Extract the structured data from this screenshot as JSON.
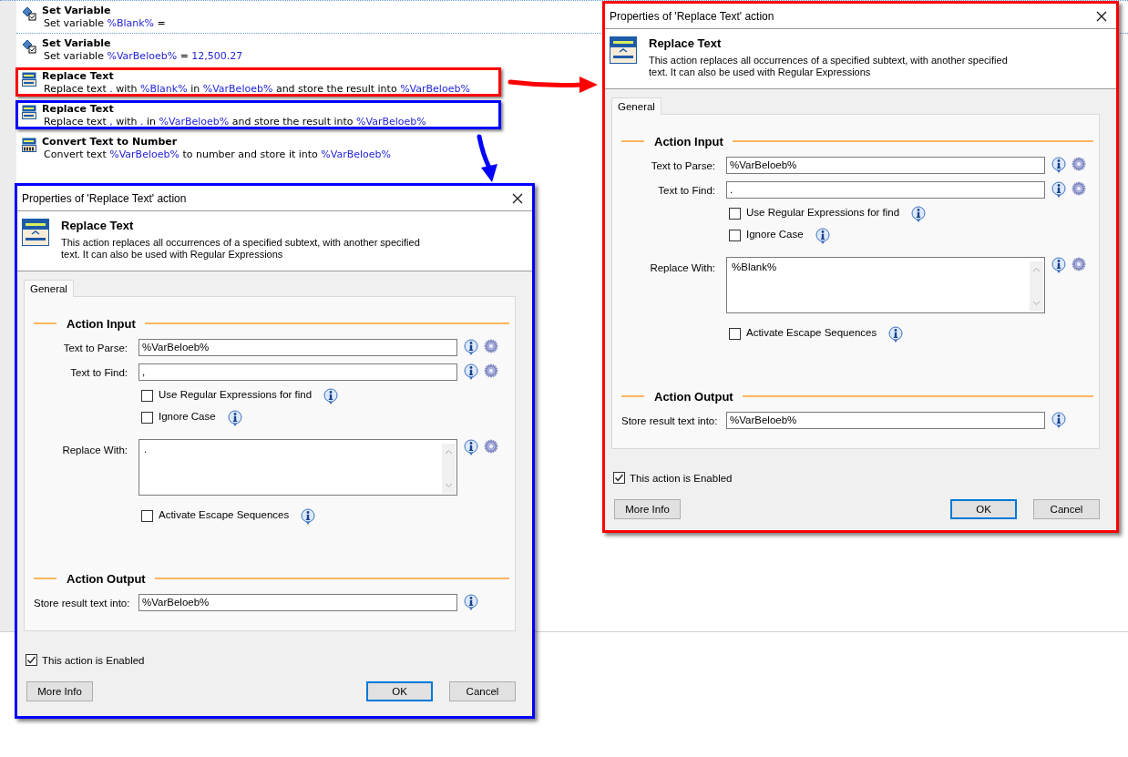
{
  "steps": [
    {
      "title": "Set Variable",
      "kind": "variable",
      "description": [
        {
          "kind": "plain",
          "text": "Set variable "
        },
        {
          "kind": "var",
          "text": "%Blank%"
        },
        {
          "kind": "plain",
          "text": " ="
        }
      ]
    },
    {
      "title": "Set Variable",
      "kind": "variable",
      "description": [
        {
          "kind": "plain",
          "text": "Set variable "
        },
        {
          "kind": "var",
          "text": "%VarBeloeb%"
        },
        {
          "kind": "plain",
          "text": " = "
        },
        {
          "kind": "var",
          "text": "12,500.27"
        }
      ]
    },
    {
      "title": "Replace Text",
      "kind": "replace",
      "color": "#ff0000",
      "description": [
        {
          "kind": "plain",
          "text": "Replace text "
        },
        {
          "kind": "var",
          "text": "."
        },
        {
          "kind": "plain",
          "text": " with "
        },
        {
          "kind": "var",
          "text": "%Blank%"
        },
        {
          "kind": "plain",
          "text": " in "
        },
        {
          "kind": "var",
          "text": "%VarBeloeb%"
        },
        {
          "kind": "plain",
          "text": " and store the result into "
        },
        {
          "kind": "var",
          "text": "%VarBeloeb%"
        }
      ]
    },
    {
      "title": "Replace Text",
      "kind": "replace",
      "color": "#0000ff",
      "description": [
        {
          "kind": "plain",
          "text": "Replace text "
        },
        {
          "kind": "var",
          "text": ","
        },
        {
          "kind": "plain",
          "text": " with "
        },
        {
          "kind": "var",
          "text": "."
        },
        {
          "kind": "plain",
          "text": " in "
        },
        {
          "kind": "var",
          "text": "%VarBeloeb%"
        },
        {
          "kind": "plain",
          "text": " and store the result into "
        },
        {
          "kind": "var",
          "text": "%VarBeloeb%"
        }
      ]
    },
    {
      "title": "Convert Text to Number",
      "kind": "convert",
      "description": [
        {
          "kind": "plain",
          "text": "Convert text "
        },
        {
          "kind": "var",
          "text": "%VarBeloeb%"
        },
        {
          "kind": "plain",
          "text": " to number and store it into "
        },
        {
          "kind": "var",
          "text": "%VarBeloeb%"
        }
      ]
    }
  ],
  "dialogs": [
    {
      "color": "#ff0000",
      "title": "Properties of 'Replace Text' action",
      "heading": "Replace Text",
      "description": "This action replaces all occurrences of a specified subtext, with another specified text. It can also be used with Regular Expressions",
      "tabs": [
        {
          "label": "General",
          "selected": true
        }
      ],
      "sections": [
        {
          "title": "Action Input",
          "rows": [
            {
              "kind": "text",
              "label": "Text to Parse:",
              "value": "%VarBeloeb%",
              "gear": true
            },
            {
              "kind": "text",
              "label": "Text to Find:",
              "value": ".",
              "gear": true
            },
            {
              "kind": "checkbox",
              "label": "Use Regular Expressions for find",
              "checked": false
            },
            {
              "kind": "checkbox",
              "label": "Ignore Case",
              "checked": false
            },
            {
              "kind": "textarea",
              "label": "Replace With:",
              "value": "%Blank%",
              "gear": true
            },
            {
              "kind": "checkbox",
              "label": "Activate Escape Sequences",
              "checked": false
            }
          ]
        },
        {
          "title": "Action Output",
          "rows": [
            {
              "kind": "text",
              "label": "Store result text into:",
              "value": "%VarBeloeb%",
              "gear": false
            }
          ]
        }
      ],
      "enabled": {
        "label": "This action is Enabled",
        "checked": true
      },
      "buttons": [
        {
          "label": "More Info",
          "default": false
        },
        {
          "label": "OK",
          "default": true
        },
        {
          "label": "Cancel",
          "default": false
        }
      ]
    },
    {
      "color": "#0000ff",
      "title": "Properties of 'Replace Text' action",
      "heading": "Replace Text",
      "description": "This action replaces all occurrences of a specified subtext, with another specified text. It can also be used with Regular Expressions",
      "tabs": [
        {
          "label": "General",
          "selected": true
        }
      ],
      "sections": [
        {
          "title": "Action Input",
          "rows": [
            {
              "kind": "text",
              "label": "Text to Parse:",
              "value": "%VarBeloeb%",
              "gear": true
            },
            {
              "kind": "text",
              "label": "Text to Find:",
              "value": ",",
              "gear": true
            },
            {
              "kind": "checkbox",
              "label": "Use Regular Expressions for find",
              "checked": false
            },
            {
              "kind": "checkbox",
              "label": "Ignore Case",
              "checked": false
            },
            {
              "kind": "textarea",
              "label": "Replace With:",
              "value": ".",
              "gear": true
            },
            {
              "kind": "checkbox",
              "label": "Activate Escape Sequences",
              "checked": false
            }
          ]
        },
        {
          "title": "Action Output",
          "rows": [
            {
              "kind": "text",
              "label": "Store result text into:",
              "value": "%VarBeloeb%",
              "gear": false
            }
          ]
        }
      ],
      "enabled": {
        "label": "This action is Enabled",
        "checked": true
      },
      "buttons": [
        {
          "label": "More Info",
          "default": false
        },
        {
          "label": "OK",
          "default": true
        },
        {
          "label": "Cancel",
          "default": false
        }
      ]
    }
  ]
}
